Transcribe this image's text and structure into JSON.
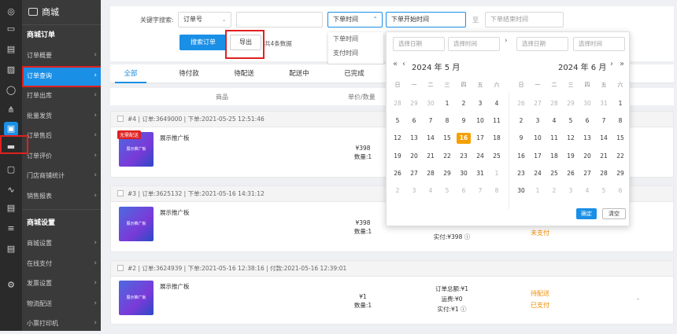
{
  "sidebar": {
    "brand": "商城",
    "sections": [
      {
        "title": "商城订单",
        "items": [
          "订单概要",
          "订单查询",
          "打单出库",
          "批量发货",
          "订单售后",
          "订单评价",
          "门店商铺统计",
          "销售报表"
        ]
      },
      {
        "title": "商城设置",
        "items": [
          "商城设置",
          "在线支付",
          "发票设置",
          "物流配送",
          "小票打印机"
        ]
      }
    ],
    "icon_names": [
      "globe-icon",
      "layout-icon",
      "doc-icon",
      "image-icon",
      "user-icon",
      "tree-icon",
      "clipboard-icon",
      "card-icon",
      "bag-icon",
      "chart-icon",
      "id-card-icon",
      "list-icon",
      "id-card-icon",
      "gear-icon"
    ]
  },
  "filters": {
    "keyword_label": "关键字搜索:",
    "keyword_type": "订单号",
    "keyword_value": "",
    "time_type": "下单时间",
    "start_placeholder": "下单开始时间",
    "to_label": "至",
    "end_placeholder": "下单结束时间",
    "search_button": "搜索订单",
    "export_button": "导出",
    "count_text": "共4条数据",
    "time_options": [
      "下单时间",
      "支付时间"
    ]
  },
  "tabs": [
    "全部",
    "待付款",
    "待配送",
    "配送中",
    "已完成"
  ],
  "table_headers": [
    "商品",
    "单价/数量"
  ],
  "orders": [
    {
      "header": "#4 | 订单:3649000 | 下单:2021-05-25 12:51:46",
      "badge": "无需配送",
      "thumb_text": "展示推广板",
      "product": "展示推广板",
      "price": "¥398",
      "qty": "数量:1"
    },
    {
      "header": "#3 | 订单:3625132 | 下单:2021-05-16 14:31:12",
      "thumb_text": "展示推广板",
      "product": "展示推广板",
      "price": "¥398",
      "qty": "数量:1",
      "paid": "实付:¥398",
      "status": "未支付"
    },
    {
      "header": "#2 | 订单:3624939 | 下单:2021-05-16 12:38:16 | 付款:2021-05-16 12:39:01",
      "thumb_text": "展示推广板",
      "product": "展示推广板",
      "price": "¥1",
      "qty": "数量:1",
      "total": "订单总额:¥1",
      "freight": "运费:¥0",
      "paid": "实付:¥1",
      "status": "待配送",
      "status2": "已支付",
      "extra": "-"
    }
  ],
  "datepicker": {
    "inputs": [
      "选择日期",
      "选择时间",
      "选择日期",
      "选择时间"
    ],
    "left_title": "2024 年 5 月",
    "right_title": "2024 年 6 月",
    "weekdays": [
      "日",
      "一",
      "二",
      "三",
      "四",
      "五",
      "六"
    ],
    "left_days": [
      "28",
      "29",
      "30",
      "1",
      "2",
      "3",
      "4",
      "5",
      "6",
      "7",
      "8",
      "9",
      "10",
      "11",
      "12",
      "13",
      "14",
      "15",
      "16",
      "17",
      "18",
      "19",
      "20",
      "21",
      "22",
      "23",
      "24",
      "25",
      "26",
      "27",
      "28",
      "29",
      "30",
      "31",
      "1",
      "2",
      "3",
      "4",
      "5",
      "6",
      "7",
      "8"
    ],
    "right_days": [
      "26",
      "27",
      "28",
      "29",
      "30",
      "31",
      "1",
      "2",
      "3",
      "4",
      "5",
      "6",
      "7",
      "8",
      "9",
      "10",
      "11",
      "12",
      "13",
      "14",
      "15",
      "16",
      "17",
      "18",
      "19",
      "20",
      "21",
      "22",
      "23",
      "24",
      "25",
      "26",
      "27",
      "28",
      "29",
      "30",
      "1",
      "2",
      "3",
      "4",
      "5",
      "6"
    ],
    "left_dim": [
      0,
      1,
      2,
      34,
      35,
      36,
      37,
      38,
      39,
      40,
      41
    ],
    "right_dim": [
      0,
      1,
      2,
      3,
      4,
      5,
      36,
      37,
      38,
      39,
      40,
      41
    ],
    "today_index": 18,
    "confirm": "确定",
    "clear": "清空"
  }
}
